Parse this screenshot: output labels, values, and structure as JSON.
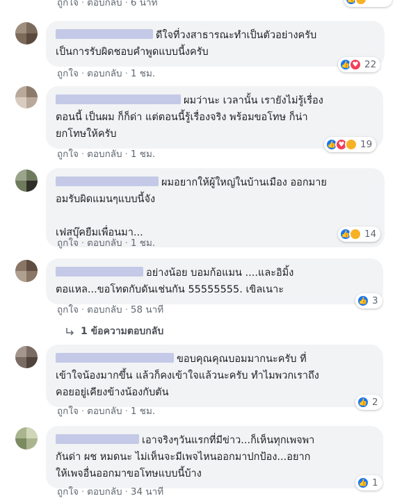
{
  "actions": {
    "like": "ถูกใจ",
    "reply": "ตอบกลับ"
  },
  "top_partial": {
    "time": "6 นาที"
  },
  "comments": [
    {
      "text": "ดีใจที่วงสาธารณะทำเป็นตัวอย่างครับ\nเป็นการรับผิดชอบคำพูดแบบนี้งครับ",
      "time": "1 ชม.",
      "reaction_count": "22",
      "reactions": [
        "like-icon",
        "love-icon"
      ]
    },
    {
      "text": "ผมว่านะ เวลานั้น เรายังไม่รู้เรื่อง\nตอนนี้ เป็นผม ก็ก็ด่า แต่ตอนนี้รู้เรื่องจริง พร้อมขอโทษ ก็น่า\nยกโทษให้ครับ",
      "time": "1 ชม.",
      "reaction_count": "19",
      "reactions": [
        "like-icon",
        "love-icon",
        "haha-icon"
      ]
    },
    {
      "text": "ผมอยากให้ผู้ใหญ่ในบ้านเมือง ออกมาย\nอมรับผิดแมนๆแบบนี้จัง\n\nเฟสบุ๊คยืมเพื่อนมา...",
      "time": "1 ชม.",
      "reaction_count": "14",
      "reactions": [
        "like-icon",
        "haha-icon"
      ]
    },
    {
      "text": "อย่างน้อย บอมก้อแมน ....และอิมิ้ง\nตอแหล...ขอโทดกับดันเช่นกัน 55555555. เขิลเนาะ",
      "time": "58 นาที",
      "reaction_count": "3",
      "reactions": [
        "like-icon"
      ]
    },
    {
      "text": "ขอบคุณคุณบอมมากนะครับ ที่\nเข้าใจน้องมากขึ้น แล้วก็คงเข้าใจแล้วนะครับ ทำไมพวกเราถึง\nคอยอยู่เคียงข้างน้องกับตัน",
      "time": "1 ชม.",
      "reaction_count": "2",
      "reactions": [
        "like-icon"
      ]
    },
    {
      "text": "เอาจริงๆวันแรกที่มีข่าว...ก็เห็นทุกเพจพา\nกันด่า ผช หมดนะ ไม่เห็นจะมีเพจไหนออกมาปกป้อง...อยาก\nให้เพจอื่นออกมาขอโทษแบบนี้บ้าง",
      "time": "34 นาที",
      "reaction_count": "1",
      "reactions": [
        "like-icon"
      ]
    }
  ],
  "reply_link": "1 ข้อความตอบกลับ",
  "colors": {
    "like": "#1877f2",
    "love": "#f33e58",
    "haha": "#f7b125",
    "bubble": "#f2f3f5",
    "meta": "#606770"
  }
}
